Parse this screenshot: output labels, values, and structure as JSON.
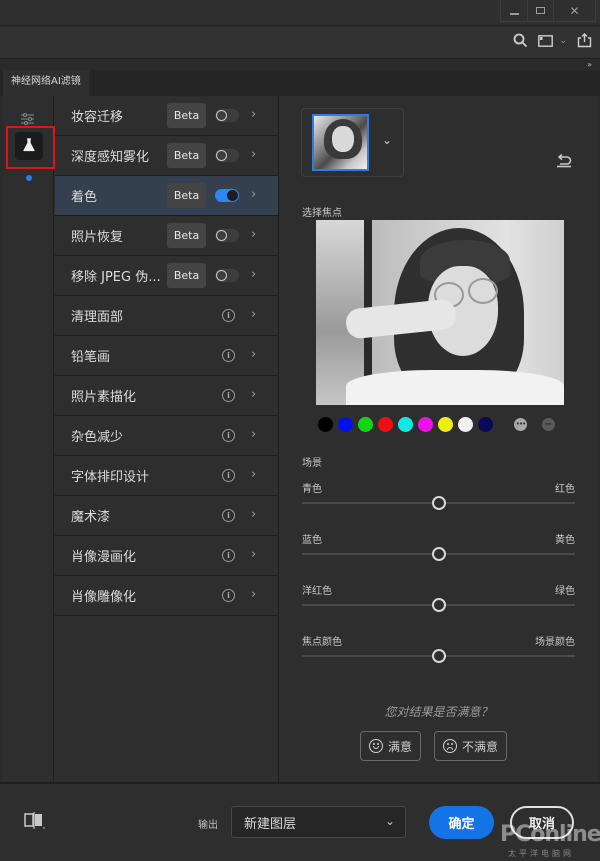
{
  "window": {
    "minimize_icon": "minimize-icon",
    "maximize_icon": "maximize-icon",
    "close_icon": "close-icon"
  },
  "toolbar": {
    "icons": [
      "search-icon",
      "panel-layout-icon",
      "chevron-down-icon",
      "share-icon"
    ]
  },
  "panel": {
    "collapse_glyph": "»",
    "tab_label": "神经网络AI滤镜"
  },
  "rail": {
    "items": [
      "adjust-icon",
      "flask-icon"
    ],
    "active": "flask-icon"
  },
  "filters": [
    {
      "name": "妆容迁移",
      "badge": "Beta",
      "toggle": false
    },
    {
      "name": "深度感知雾化",
      "badge": "Beta",
      "toggle": false
    },
    {
      "name": "着色",
      "badge": "Beta",
      "toggle": true,
      "active": true
    },
    {
      "name": "照片恢复",
      "badge": "Beta",
      "toggle": false
    },
    {
      "name": "移除 JPEG 伪...",
      "badge": "Beta",
      "toggle": false
    },
    {
      "name": "清理面部",
      "info": true
    },
    {
      "name": "铅笔画",
      "info": true
    },
    {
      "name": "照片素描化",
      "info": true
    },
    {
      "name": "杂色减少",
      "info": true
    },
    {
      "name": "字体排印设计",
      "info": true
    },
    {
      "name": "魔术漆",
      "info": true
    },
    {
      "name": "肖像漫画化",
      "info": true
    },
    {
      "name": "肖像雕像化",
      "info": true
    }
  ],
  "detail": {
    "focus_label": "选择焦点",
    "swatches": [
      "#000000",
      "#0010ee",
      "#10d810",
      "#ee1010",
      "#10e8e8",
      "#ee10ee",
      "#eeee10",
      "#f0f0f0",
      "#0a0a5a"
    ],
    "more_glyph": "•••",
    "minus_glyph": "−",
    "scene_label": "场景",
    "sliders": [
      {
        "left": "青色",
        "right": "红色",
        "value": 0.5
      },
      {
        "left": "蓝色",
        "right": "黄色",
        "value": 0.5
      },
      {
        "left": "洋红色",
        "right": "绿色",
        "value": 0.5
      },
      {
        "left": "焦点颜色",
        "right": "场景颜色",
        "value": 0.5
      }
    ],
    "question": "您对结果是否满意？",
    "satisfied": "满意",
    "unsatisfied": "不满意"
  },
  "footer": {
    "output_label": "输出",
    "output_value": "新建图层",
    "ok": "确定",
    "cancel": "取消",
    "watermark": "PConline",
    "watermark_sub": "太平洋电脑网"
  },
  "colors": {
    "accent": "#1473e6",
    "active_row": "#34404e",
    "highlight": "#e0141b"
  }
}
